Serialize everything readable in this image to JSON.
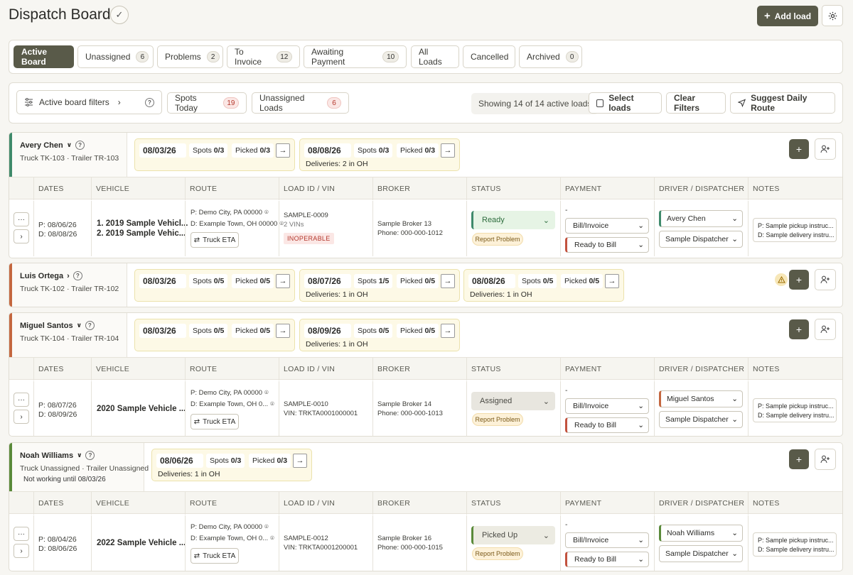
{
  "header": {
    "title": "Dispatch Board",
    "add_load_label": "Add load"
  },
  "tabs": [
    {
      "label": "Active Board",
      "count": null
    },
    {
      "label": "Unassigned",
      "count": "6"
    },
    {
      "label": "Problems",
      "count": "2"
    },
    {
      "label": "To Invoice",
      "count": "12"
    },
    {
      "label": "Awaiting Payment",
      "count": "10"
    },
    {
      "label": "All Loads",
      "count": null
    },
    {
      "label": "Cancelled",
      "count": null
    },
    {
      "label": "Archived",
      "count": "0"
    }
  ],
  "filters": {
    "active_board_filters": "Active board filters",
    "spots_today": "Spots Today",
    "spots_today_count": "19",
    "unassigned_loads": "Unassigned Loads",
    "unassigned_loads_count": "6",
    "showing": "Showing 14 of 14 active loads",
    "select_loads": "Select loads",
    "clear_filters": "Clear Filters",
    "suggest_route": "Suggest Daily Route"
  },
  "table_headers": [
    "DATES",
    "VEHICLE",
    "ROUTE",
    "LOAD ID / VIN",
    "BROKER",
    "STATUS",
    "PAYMENT",
    "DRIVER / DISPATCHER",
    "NOTES"
  ],
  "common": {
    "spots": "Spots",
    "picked": "Picked",
    "truck_eta": "Truck ETA",
    "report_problem": "Report Problem",
    "bill_invoice": "Bill/Invoice",
    "ready_to_bill": "Ready to Bill",
    "dispatcher": "Sample Dispatcher",
    "note_pickup": "P: Sample pickup instruc...",
    "note_delivery": "D: Sample delivery instru...",
    "dash": "-",
    "route_p": "P:  Demo City, PA 00000",
    "route_d_full": "D:  Example Town, OH 00000",
    "route_d_short": "D:  Example Town, OH 0..."
  },
  "drivers": [
    {
      "name": "Avery Chen",
      "truck": "Truck TK-103 · Trailer TR-103",
      "color": "#3f8a6b",
      "dates": [
        {
          "date": "08/03/26",
          "spots": "0/3",
          "picked": "0/3",
          "deliveries": ""
        },
        {
          "date": "08/08/26",
          "spots": "0/3",
          "picked": "0/3",
          "deliveries": "Deliveries: 2 in OH"
        }
      ],
      "load": {
        "pickup_date": "P: 08/06/26",
        "delivery_date": "D: 08/08/26",
        "vehicle1": "1. 2019 Sample Vehicl...",
        "vehicle2": "2. 2019 Sample Vehic...",
        "load_id": "SAMPLE-0009",
        "vin": "2 VINs",
        "badge": "INOPERABLE",
        "broker": "Sample Broker 13",
        "phone": "Phone: 000-000-1012",
        "status": "Ready",
        "driver": "Avery Chen"
      }
    },
    {
      "name": "Luis Ortega",
      "truck": "Truck TK-102 · Trailer TR-102",
      "color": "#c4673f",
      "dates": [
        {
          "date": "08/03/26",
          "spots": "0/5",
          "picked": "0/5",
          "deliveries": ""
        },
        {
          "date": "08/07/26",
          "spots": "1/5",
          "picked": "0/5",
          "deliveries": "Deliveries: 1 in OH"
        },
        {
          "date": "08/08/26",
          "spots": "0/5",
          "picked": "0/5",
          "deliveries": "Deliveries: 1 in OH"
        }
      ]
    },
    {
      "name": "Miguel Santos",
      "truck": "Truck TK-104 · Trailer TR-104",
      "color": "#c4673f",
      "dates": [
        {
          "date": "08/03/26",
          "spots": "0/5",
          "picked": "0/5",
          "deliveries": ""
        },
        {
          "date": "08/09/26",
          "spots": "0/5",
          "picked": "0/5",
          "deliveries": "Deliveries: 1 in OH"
        }
      ],
      "load": {
        "pickup_date": "P: 08/07/26",
        "delivery_date": "D: 08/09/26",
        "vehicle1": "2020 Sample Vehicle ...",
        "load_id": "SAMPLE-0010",
        "vin": "VIN: TRKTA0001000001",
        "broker": "Sample Broker 14",
        "phone": "Phone: 000-000-1013",
        "status": "Assigned",
        "driver": "Miguel Santos"
      }
    },
    {
      "name": "Noah Williams",
      "truck": "Truck Unassigned · Trailer Unassigned",
      "note": "Not working until 08/03/26",
      "color": "#5a8a3a",
      "dates": [
        {
          "date": "08/06/26",
          "spots": "0/3",
          "picked": "0/3",
          "deliveries": "Deliveries: 1 in OH"
        }
      ],
      "load": {
        "pickup_date": "P: 08/04/26",
        "delivery_date": "D: 08/06/26",
        "vehicle1": "2022 Sample Vehicle ...",
        "load_id": "SAMPLE-0012",
        "vin": "VIN: TRKTA0001200001",
        "broker": "Sample Broker 16",
        "phone": "Phone: 000-000-1015",
        "status": "Picked Up",
        "driver": "Noah Williams"
      }
    }
  ]
}
